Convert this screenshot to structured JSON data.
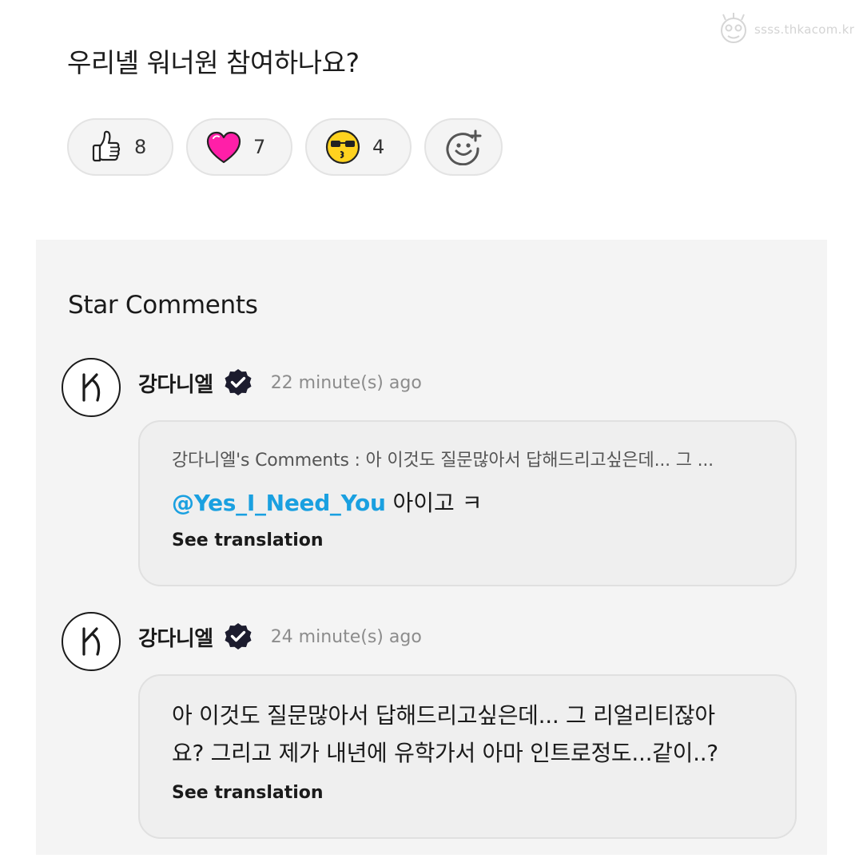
{
  "watermark": {
    "text": "ssss.thkacom.kr"
  },
  "post": {
    "title": "우리녤 워너원 참여하나요?"
  },
  "reactions": [
    {
      "icon": "thumbs-up-icon",
      "count": "8"
    },
    {
      "icon": "heart-icon",
      "count": "7"
    },
    {
      "icon": "sunglasses-kiss-face-icon",
      "count": "4"
    }
  ],
  "add_reaction_icon": "smiley-plus-icon",
  "colors": {
    "mention": "#1aa0e0",
    "heart": "#ff1fa8",
    "emoji_face": "#ffd21f",
    "panel_bg": "#f4f4f4",
    "verified_badge": "#1c1c2e"
  },
  "star_comments": {
    "title": "Star Comments",
    "items": [
      {
        "author": "강다니엘",
        "verified_icon": "verified-badge-icon",
        "time": "22 minute(s) ago",
        "reply_context": "강다니엘's Comments : 아 이것도 질문많아서 답해드리고싶은데... 그 ...",
        "mention": "@Yes_I_Need_You",
        "text": "아이고 ㅋ",
        "see_translation": "See translation"
      },
      {
        "author": "강다니엘",
        "verified_icon": "verified-badge-icon",
        "time": "24 minute(s) ago",
        "text_line1": "아 이것도 질문많아서 답해드리고싶은데... 그 리얼리티잖아",
        "text_line2": "요? 그리고 제가 내년에 유학가서 아마 인트로정도...같이..?",
        "see_translation": "See translation"
      }
    ]
  }
}
